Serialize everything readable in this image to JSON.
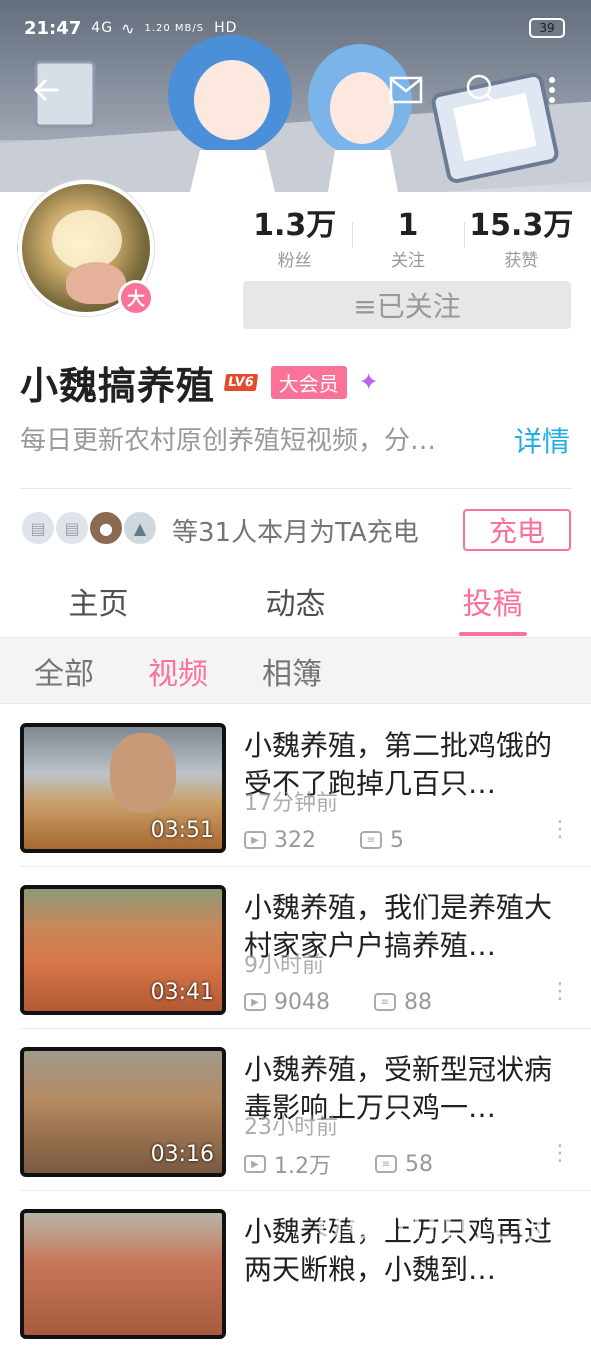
{
  "status_bar": {
    "time": "21:47",
    "signal": "4G",
    "net_speed": "1.20 MB/S",
    "hd": "HD",
    "battery": "39"
  },
  "header": {
    "back_icon": "back-arrow-icon",
    "mail_icon": "mail-icon",
    "search_icon": "search-icon",
    "more_icon": "more-vertical-icon"
  },
  "profile": {
    "avatar_badge": "大",
    "stats": [
      {
        "value": "1.3万",
        "label": "粉丝"
      },
      {
        "value": "1",
        "label": "关注"
      },
      {
        "value": "15.3万",
        "label": "获赞"
      }
    ],
    "follow_button": "≡已关注",
    "name": "小魏搞养殖",
    "level": "LV6",
    "vip": "大会员",
    "intro": "每日更新农村原创养殖短视频，分…",
    "details": "详情"
  },
  "charge": {
    "text": "等31人本月为TA充电",
    "button": "充电"
  },
  "tabs": {
    "items": [
      {
        "label": "主页"
      },
      {
        "label": "动态"
      },
      {
        "label": "投稿"
      }
    ],
    "active": "投稿"
  },
  "subtabs": {
    "items": [
      {
        "label": "全部"
      },
      {
        "label": "视频"
      },
      {
        "label": "相簿"
      }
    ],
    "active": "视频"
  },
  "videos": [
    {
      "title": "小魏养殖，第二批鸡饿的受不了跑掉几百只…",
      "time": "17分钟前",
      "duration": "03:51",
      "views": "322",
      "comments": "5"
    },
    {
      "title": "小魏养殖，我们是养殖大村家家户户搞养殖…",
      "time": "9小时前",
      "duration": "03:41",
      "views": "9048",
      "comments": "88"
    },
    {
      "title": "小魏养殖，受新型冠状病毒影响上万只鸡一…",
      "time": "23小时前",
      "duration": "03:16",
      "views": "1.2万",
      "comments": "58"
    },
    {
      "title": "小魏养殖，上万只鸡再过两天断粮，小魏到…",
      "time": "",
      "duration": "",
      "views": "",
      "comments": ""
    }
  ],
  "watermark": "gdmm.com",
  "colors": {
    "accent": "#fb7299",
    "link": "#23ade5",
    "muted": "#999999"
  }
}
